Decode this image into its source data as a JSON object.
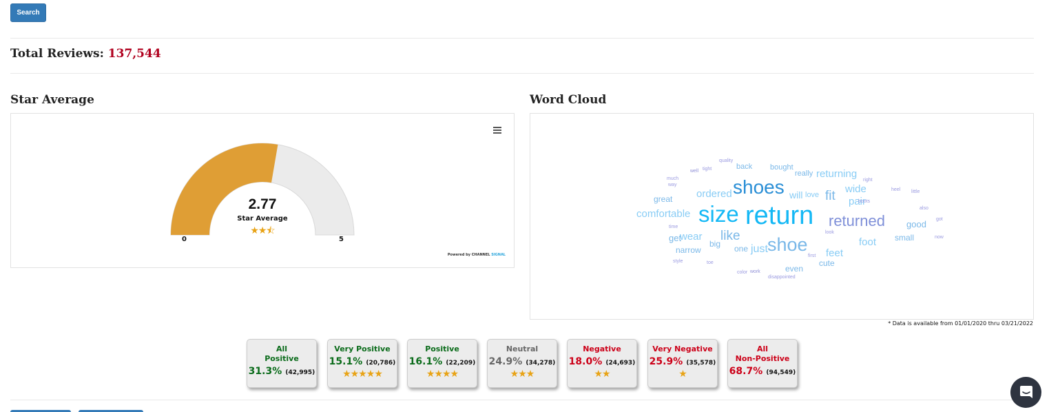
{
  "toolbar": {
    "search_label": "Search"
  },
  "summary": {
    "total_label": "Total Reviews:",
    "total_value": "137,544"
  },
  "star_average": {
    "title": "Star Average",
    "value": "2.77",
    "value_num": 2.77,
    "label": "Star Average",
    "stars": "★★⯪",
    "min_label": "0",
    "max_label": "5",
    "min": 0,
    "max": 5,
    "fill_color": "#df9e35",
    "track_color": "#ebebeb",
    "credit_prefix": "Powered by",
    "credit_brand_1": "CHANNEL",
    "credit_brand_2": "SIGNAL"
  },
  "word_cloud": {
    "title": "Word Cloud",
    "words": [
      {
        "text": "quality",
        "color": "#9a9ae0"
      },
      {
        "text": "well",
        "color": "#8f8fd6"
      },
      {
        "text": "tight",
        "color": "#9a9ae0"
      },
      {
        "text": "back",
        "color": "#7ab8e8"
      },
      {
        "text": "bought",
        "color": "#7ab8e8"
      },
      {
        "text": "really",
        "color": "#7ab8e8"
      },
      {
        "text": "returning",
        "color": "#88ccf5"
      },
      {
        "text": "right",
        "color": "#9a9ae0"
      },
      {
        "text": "much",
        "color": "#9a9ae0"
      },
      {
        "text": "way",
        "color": "#9a9ae0"
      },
      {
        "text": "ordered",
        "color": "#88ccf5"
      },
      {
        "text": "shoes",
        "color": "#2b8fd6"
      },
      {
        "text": "will",
        "color": "#88ccf5"
      },
      {
        "text": "love",
        "color": "#88ccf5"
      },
      {
        "text": "fit",
        "color": "#7ab8e8"
      },
      {
        "text": "wide",
        "color": "#88ccf5"
      },
      {
        "text": "heel",
        "color": "#9a9ae0"
      },
      {
        "text": "little",
        "color": "#9a9ae0"
      },
      {
        "text": "great",
        "color": "#7ab8e8"
      },
      {
        "text": "pair",
        "color": "#88ccf5"
      },
      {
        "text": "boots",
        "color": "#9a9ae0"
      },
      {
        "text": "also",
        "color": "#9a9ae0"
      },
      {
        "text": "comfortable",
        "color": "#88ccf5"
      },
      {
        "text": "size",
        "color": "#14b8f5"
      },
      {
        "text": "return",
        "color": "#14b8f5"
      },
      {
        "text": "returned",
        "color": "#7e8fd8"
      },
      {
        "text": "got",
        "color": "#9a9ae0"
      },
      {
        "text": "good",
        "color": "#7ab8e8"
      },
      {
        "text": "time",
        "color": "#9a9ae0"
      },
      {
        "text": "look",
        "color": "#9a9ae0"
      },
      {
        "text": "get",
        "color": "#7ab8e8"
      },
      {
        "text": "wear",
        "color": "#88ccf5"
      },
      {
        "text": "like",
        "color": "#7ab8e8"
      },
      {
        "text": "foot",
        "color": "#88ccf5"
      },
      {
        "text": "small",
        "color": "#7ab8e8"
      },
      {
        "text": "now",
        "color": "#9a9ae0"
      },
      {
        "text": "narrow",
        "color": "#7ab8e8"
      },
      {
        "text": "big",
        "color": "#7ab8e8"
      },
      {
        "text": "one",
        "color": "#7ab8e8"
      },
      {
        "text": "just",
        "color": "#88ccf5"
      },
      {
        "text": "shoe",
        "color": "#7ab8e8"
      },
      {
        "text": "first",
        "color": "#9a9ae0"
      },
      {
        "text": "feet",
        "color": "#88ccf5"
      },
      {
        "text": "style",
        "color": "#9a9ae0"
      },
      {
        "text": "toe",
        "color": "#9a9ae0"
      },
      {
        "text": "cute",
        "color": "#7ab8e8"
      },
      {
        "text": "even",
        "color": "#7ab8e8"
      },
      {
        "text": "color",
        "color": "#9a9ae0"
      },
      {
        "text": "work",
        "color": "#8f8fd6"
      },
      {
        "text": "disappointed",
        "color": "#9a9ae0"
      }
    ],
    "footnote": "* Data is available from 01/01/2020 thru 03/21/2022"
  },
  "sentiment_cards": [
    {
      "label_line1": "All",
      "label_line2": "Positive",
      "percent": "31.3%",
      "count": "(42,995)",
      "stars": "",
      "tone": "pos"
    },
    {
      "label_line1": "Very Positive",
      "label_line2": "",
      "percent": "15.1%",
      "count": "(20,786)",
      "stars": "★★★★★",
      "tone": "pos"
    },
    {
      "label_line1": "Positive",
      "label_line2": "",
      "percent": "16.1%",
      "count": "(22,209)",
      "stars": "★★★★",
      "tone": "pos"
    },
    {
      "label_line1": "Neutral",
      "label_line2": "",
      "percent": "24.9%",
      "count": "(34,278)",
      "stars": "★★★",
      "tone": "neu"
    },
    {
      "label_line1": "Negative",
      "label_line2": "",
      "percent": "18.0%",
      "count": "(24,693)",
      "stars": "★★",
      "tone": "neg"
    },
    {
      "label_line1": "Very Negative",
      "label_line2": "",
      "percent": "25.9%",
      "count": "(35,578)",
      "stars": "★",
      "tone": "neg"
    },
    {
      "label_line1": "All",
      "label_line2": "Non-Positive",
      "percent": "68.7%",
      "count": "(94,549)",
      "stars": "",
      "tone": "neg"
    }
  ],
  "chat": {
    "icon": "chat-bubble-icon"
  }
}
